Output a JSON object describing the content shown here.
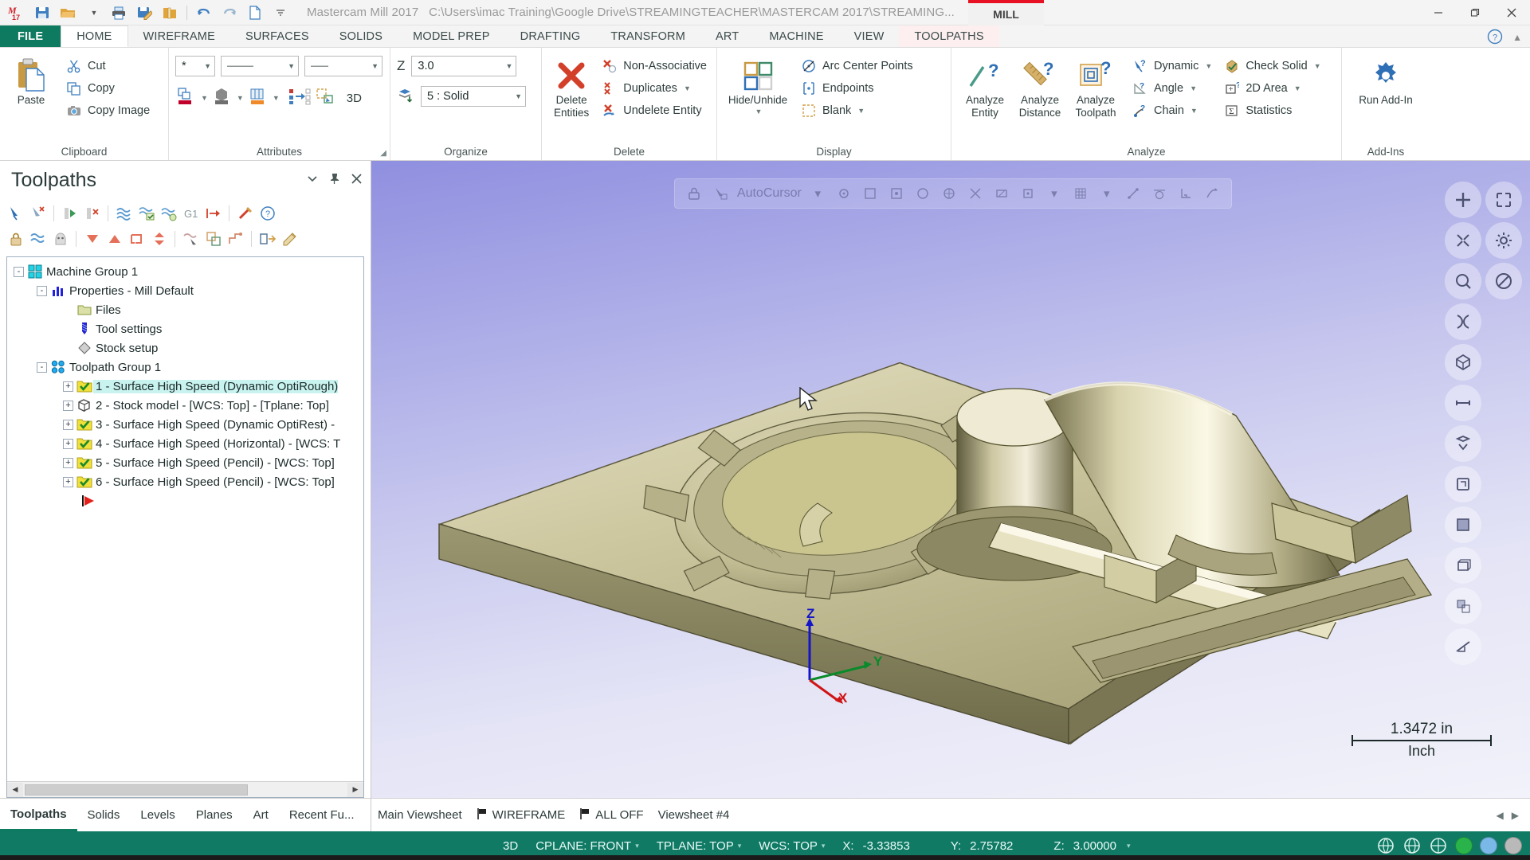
{
  "titlebar": {
    "app_title": "Mastercam Mill 2017",
    "file_path": "C:\\Users\\imac Training\\Google Drive\\STREAMINGTEACHER\\MASTERCAM 2017\\STREAMING...",
    "product_tab": "MILL",
    "accent_red": "#e81123",
    "qat": [
      {
        "name": "mastercam-logo-icon",
        "label": "M17"
      },
      {
        "name": "save-icon",
        "label": "Save"
      },
      {
        "name": "open-folder-icon",
        "label": "Open"
      },
      {
        "name": "open-dropdown-caret",
        "label": ""
      },
      {
        "name": "print-icon",
        "label": "Print"
      },
      {
        "name": "save-as-icon",
        "label": "Save As"
      },
      {
        "name": "zip2go-icon",
        "label": "Zip2Go"
      },
      {
        "name": "undo-icon",
        "label": "Undo"
      },
      {
        "name": "redo-icon",
        "label": "Redo"
      },
      {
        "name": "new-file-icon",
        "label": "New"
      },
      {
        "name": "customize-qat-caret",
        "label": ""
      }
    ],
    "window_buttons": [
      "minimize",
      "restore",
      "close"
    ]
  },
  "ribbon": {
    "tabs": [
      {
        "label": "FILE",
        "state": "file"
      },
      {
        "label": "HOME",
        "state": "active"
      },
      {
        "label": "WIREFRAME",
        "state": "normal"
      },
      {
        "label": "SURFACES",
        "state": "normal"
      },
      {
        "label": "SOLIDS",
        "state": "normal"
      },
      {
        "label": "MODEL PREP",
        "state": "normal"
      },
      {
        "label": "DRAFTING",
        "state": "normal"
      },
      {
        "label": "TRANSFORM",
        "state": "normal"
      },
      {
        "label": "ART",
        "state": "normal"
      },
      {
        "label": "MACHINE",
        "state": "normal"
      },
      {
        "label": "VIEW",
        "state": "normal"
      },
      {
        "label": "TOOLPATHS",
        "state": "contextual"
      }
    ],
    "groups": {
      "clipboard": {
        "title": "Clipboard",
        "paste": "Paste",
        "cut": "Cut",
        "copy": "Copy",
        "copy_image": "Copy Image"
      },
      "attributes": {
        "title": "Attributes",
        "point_style_value": "*",
        "line_style_value": "———",
        "line_width_value": "——",
        "label_3d": "3D"
      },
      "organize": {
        "title": "Organize",
        "z_label": "Z",
        "z_value": "3.0",
        "level_value": "5 : Solid"
      },
      "delete": {
        "title": "Delete",
        "delete_entities": "Delete Entities",
        "non_associative": "Non-Associative",
        "duplicates": "Duplicates",
        "undelete_entity": "Undelete Entity"
      },
      "display": {
        "title": "Display",
        "hide_unhide": "Hide/Unhide",
        "arc_center_points": "Arc Center Points",
        "endpoints": "Endpoints",
        "blank": "Blank"
      },
      "analyze": {
        "title": "Analyze",
        "analyze_entity": "Analyze Entity",
        "analyze_distance": "Analyze Distance",
        "analyze_toolpath": "Analyze Toolpath",
        "dynamic": "Dynamic",
        "angle": "Angle",
        "chain": "Chain",
        "check_solid": "Check Solid",
        "area_2d": "2D Area",
        "statistics": "Statistics"
      },
      "addins": {
        "title": "Add-Ins",
        "run_add_in": "Run Add-In"
      }
    }
  },
  "toolpaths_panel": {
    "title": "Toolpaths",
    "header_icons": [
      "chevron-down-icon",
      "pin-icon",
      "close-icon"
    ],
    "toolbar_row1": [
      "select-all-operations-icon",
      "select-none-operations-icon",
      "regenerate-selected-icon",
      "regenerate-dirty-icon",
      "backplot-icon",
      "verify-icon",
      "simulate-icon",
      "g1-post-icon",
      "high-feed-icon",
      "tool-manager-icon",
      "help-icon"
    ],
    "toolbar_row2": [
      "lock-icon",
      "toggle-posting-icon",
      "toggle-display-icon",
      "move-down-icon",
      "move-up-icon",
      "single-selection-icon",
      "expand-collapse-icon",
      "toolpath-display-icon",
      "copy-operation-icon",
      "drill-point-icon",
      "import-icon",
      "edit-icon"
    ],
    "tree": [
      {
        "level": 0,
        "icon": "machine-group-icon",
        "label": "Machine Group 1",
        "expander": "-",
        "selected": false
      },
      {
        "level": 1,
        "icon": "properties-icon",
        "label": "Properties - Mill Default",
        "expander": "-",
        "selected": false
      },
      {
        "level": 2,
        "icon": "files-folder-icon",
        "label": "Files",
        "expander": "",
        "selected": false
      },
      {
        "level": 2,
        "icon": "tool-settings-icon",
        "label": "Tool settings",
        "expander": "",
        "selected": false
      },
      {
        "level": 2,
        "icon": "stock-setup-icon",
        "label": "Stock setup",
        "expander": "",
        "selected": false
      },
      {
        "level": 1,
        "icon": "toolpath-group-icon",
        "label": "Toolpath Group 1",
        "expander": "-",
        "selected": false
      },
      {
        "level": 2,
        "icon": "toolpath-folder-icon",
        "label": "1 - Surface High Speed (Dynamic OptiRough)",
        "expander": "+",
        "selected": true
      },
      {
        "level": 2,
        "icon": "stock-model-icon",
        "label": "2 - Stock model - [WCS: Top] - [Tplane: Top]",
        "expander": "+",
        "selected": false
      },
      {
        "level": 2,
        "icon": "toolpath-folder-icon",
        "label": "3 - Surface High Speed (Dynamic OptiRest) -",
        "expander": "+",
        "selected": false
      },
      {
        "level": 2,
        "icon": "toolpath-folder-icon",
        "label": "4 - Surface High Speed (Horizontal) - [WCS: T",
        "expander": "+",
        "selected": false
      },
      {
        "level": 2,
        "icon": "toolpath-folder-icon",
        "label": "5 - Surface High Speed (Pencil) - [WCS: Top]",
        "expander": "+",
        "selected": false
      },
      {
        "level": 2,
        "icon": "toolpath-folder-icon",
        "label": "6 - Surface High Speed (Pencil) - [WCS: Top]",
        "expander": "+",
        "selected": false
      },
      {
        "level": 2,
        "icon": "insert-arrow-icon",
        "label": "",
        "expander": "",
        "selected": false
      }
    ]
  },
  "viewport": {
    "autocursor_label": "AutoCursor",
    "autocursor_icons": [
      "lock-icon",
      "autocursor-icon",
      "caret-icon",
      "origin-icon",
      "endpoint-snap-icon",
      "midpoint-snap-icon",
      "center-snap-icon",
      "quadrant-snap-icon",
      "intersection-snap-icon",
      "nearest-snap-icon",
      "point-snap-icon",
      "caret-icon",
      "grid-snap-icon",
      "caret-icon",
      "relative-snap-icon",
      "tangent-snap-icon",
      "perpendicular-snap-icon",
      "along-entity-icon"
    ],
    "view_tools": [
      [
        "fit-screen-icon",
        "zoom-window-icon"
      ],
      [
        "zoom-out-icon",
        "gear-icon"
      ],
      [
        "unzoom-icon",
        "no-entry-icon"
      ],
      [
        "dynamic-rotate-icon",
        ""
      ],
      [
        "isometric-view-icon",
        ""
      ],
      [
        "front-view-icon",
        ""
      ],
      [
        "top-view-icon",
        ""
      ],
      [
        "right-view-icon",
        ""
      ],
      [
        "shaded-view-icon",
        ""
      ],
      [
        "wireframe-view-icon",
        ""
      ],
      [
        "translucency-icon",
        ""
      ],
      [
        "section-view-icon",
        ""
      ]
    ],
    "axis_labels": {
      "x": "X",
      "y": "Y",
      "z": "Z"
    },
    "scale_value": "1.3472 in",
    "scale_unit": "Inch"
  },
  "bottom": {
    "tabs": [
      {
        "label": "Toolpaths",
        "active": true
      },
      {
        "label": "Solids",
        "active": false
      },
      {
        "label": "Levels",
        "active": false
      },
      {
        "label": "Planes",
        "active": false
      },
      {
        "label": "Art",
        "active": false
      },
      {
        "label": "Recent Fu...",
        "active": false
      }
    ],
    "viewsheet": {
      "main": "Main Viewsheet",
      "wireframe": "WIREFRAME",
      "all_off": "ALL OFF",
      "sheet4": "Viewsheet #4"
    }
  },
  "status": {
    "mode_3d": "3D",
    "cplane_label": "CPLANE: FRONT",
    "tplane_label": "TPLANE: TOP",
    "wcs_label": "WCS: TOP",
    "x_label": "X:",
    "x_value": "-3.33853",
    "y_label": "Y:",
    "y_value": "2.75782",
    "z_label": "Z:",
    "z_value": "3.00000",
    "right_icons": [
      "sphere-icon",
      "globe-icon",
      "half-globe-icon"
    ],
    "swatches": [
      "#29b34a",
      "#7ab8e8",
      "#b9b9b9"
    ],
    "bar_color": "#107a65"
  }
}
